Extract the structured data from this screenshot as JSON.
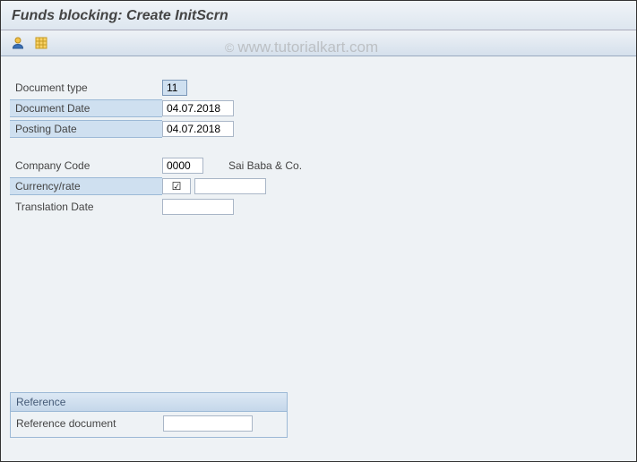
{
  "header": {
    "title": "Funds blocking: Create InitScrn"
  },
  "toolbar": {
    "icons": [
      {
        "name": "user-icon"
      },
      {
        "name": "layout-icon"
      }
    ]
  },
  "form": {
    "document_type": {
      "label": "Document type",
      "value": "11"
    },
    "document_date": {
      "label": "Document Date",
      "value": "04.07.2018"
    },
    "posting_date": {
      "label": "Posting Date",
      "value": "04.07.2018"
    },
    "company_code": {
      "label": "Company Code",
      "value": "0000",
      "desc": "Sai Baba & Co."
    },
    "currency_rate": {
      "label": "Currency/rate",
      "cur_value": "☑",
      "rate_value": ""
    },
    "translation_date": {
      "label": "Translation Date",
      "value": ""
    }
  },
  "reference": {
    "title": "Reference",
    "document_label": "Reference document",
    "document_value": ""
  },
  "watermark": {
    "copy": "©",
    "text": "www.tutorialkart.com"
  }
}
